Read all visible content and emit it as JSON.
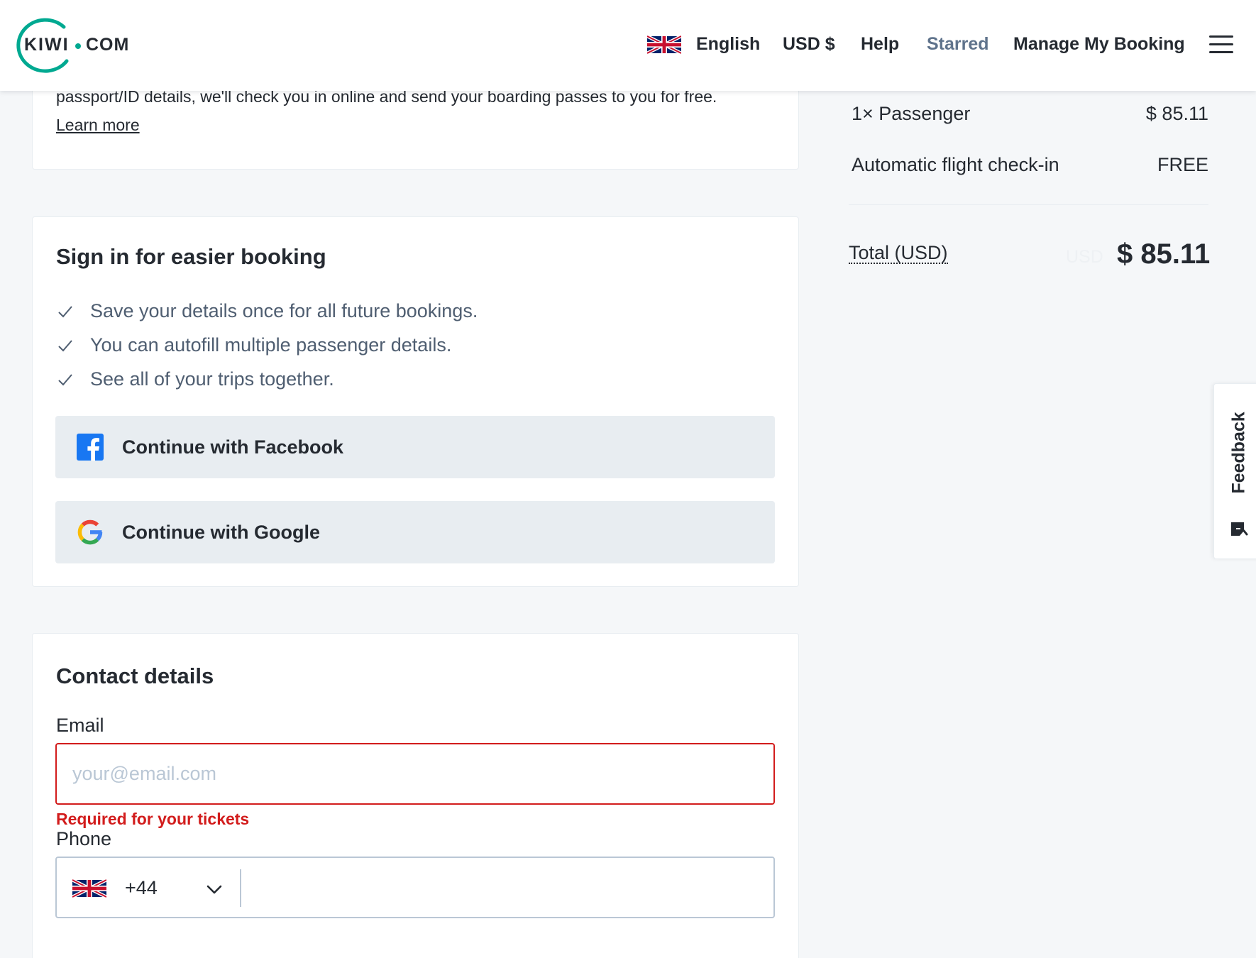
{
  "header": {
    "logo_left": "KIWI",
    "logo_right": "COM",
    "language": "English",
    "currency": "USD $",
    "help": "Help",
    "starred": "Starred",
    "manage_booking": "Manage My Booking"
  },
  "checkin_card": {
    "text": "passport/ID details, we'll check you in online and send your boarding passes to you for free.",
    "learn_more": "Learn more"
  },
  "signin": {
    "title": "Sign in for easier booking",
    "benefits": [
      "Save your details once for all future bookings.",
      "You can autofill multiple passenger details.",
      "See all of your trips together."
    ],
    "facebook_label": "Continue with Facebook",
    "google_label": "Continue with Google"
  },
  "contact": {
    "title": "Contact details",
    "email_label": "Email",
    "email_placeholder": "your@email.com",
    "email_value": "",
    "email_error": "Required for your tickets",
    "phone_label": "Phone",
    "phone_code": "+44",
    "phone_value": ""
  },
  "summary": {
    "passenger_label": "1× Passenger",
    "passenger_price": "$ 85.11",
    "checkin_label": "Automatic flight check-in",
    "checkin_price": "FREE",
    "total_label": "Total (USD)",
    "total_ghost": "USD",
    "total_value": "$ 85.11"
  },
  "feedback": {
    "label": "Feedback"
  },
  "colors": {
    "brand": "#00a991",
    "error": "#d21c1c",
    "button_bg": "#e8edf1",
    "facebook": "#1877f2"
  },
  "icons": [
    "uk-flag-icon",
    "menu-icon",
    "check-icon",
    "facebook-icon",
    "google-icon",
    "chevron-down-icon",
    "feedback-icon"
  ]
}
